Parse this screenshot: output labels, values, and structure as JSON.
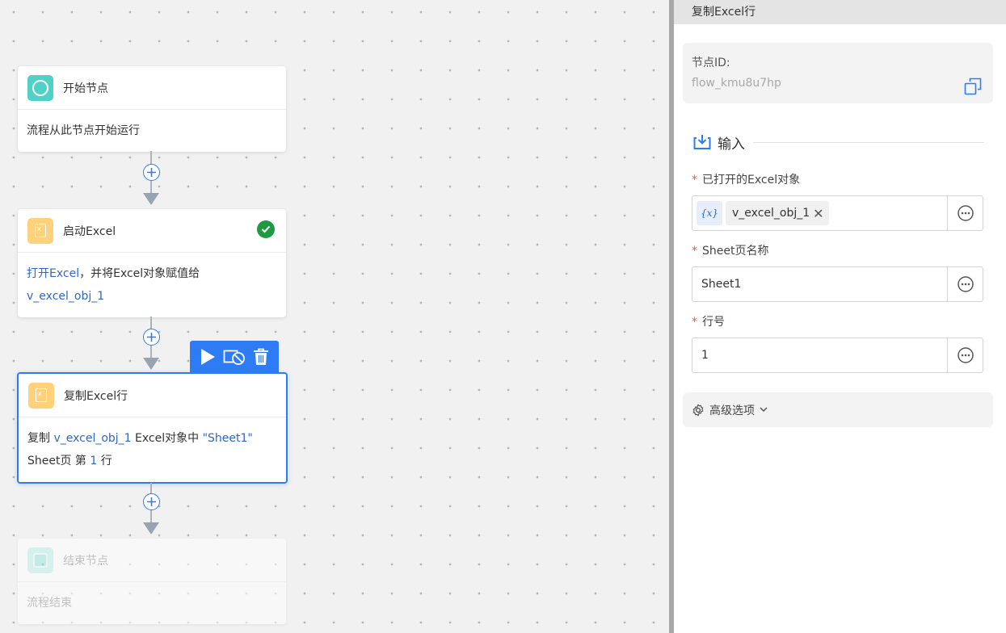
{
  "canvas": {
    "nodes": [
      {
        "title": "开始节点",
        "description": "流程从此节点开始运行"
      },
      {
        "title": "启动Excel",
        "status": "success",
        "description_parts": [
          "打开Excel",
          "，并将Excel对象赋值给",
          "v_excel_obj_1"
        ]
      },
      {
        "title": "复制Excel行",
        "selected": true,
        "description_parts": [
          "复制 ",
          "v_excel_obj_1",
          " Excel对象中 ",
          "\"Sheet1\"",
          "Sheet页 第 ",
          "1",
          " 行"
        ]
      },
      {
        "title": "结束节点",
        "description": "流程结束"
      }
    ],
    "toolbar": {
      "run_icon": "play-icon",
      "disable_icon": "disable-icon",
      "delete_icon": "trash-icon"
    }
  },
  "panel": {
    "header_title": "复制Excel行",
    "node_id_label": "节点ID:",
    "node_id_value": "flow_kmu8u7hp",
    "input_section_title": "输入",
    "fields": [
      {
        "label": "已打开的Excel对象",
        "required": true,
        "tag_icon": "{x}",
        "value": "v_excel_obj_1"
      },
      {
        "label": "Sheet页名称",
        "required": true,
        "value": "Sheet1"
      },
      {
        "label": "行号",
        "required": true,
        "value": "1"
      }
    ],
    "advanced_label": "高级选项"
  },
  "colors": {
    "accent": "#2d7cf6",
    "variable": "#2f67c9",
    "required": "#e5553d",
    "success": "#1e9a43",
    "start_node": "#4fd1c5",
    "excel_node": "#ffd17a"
  }
}
